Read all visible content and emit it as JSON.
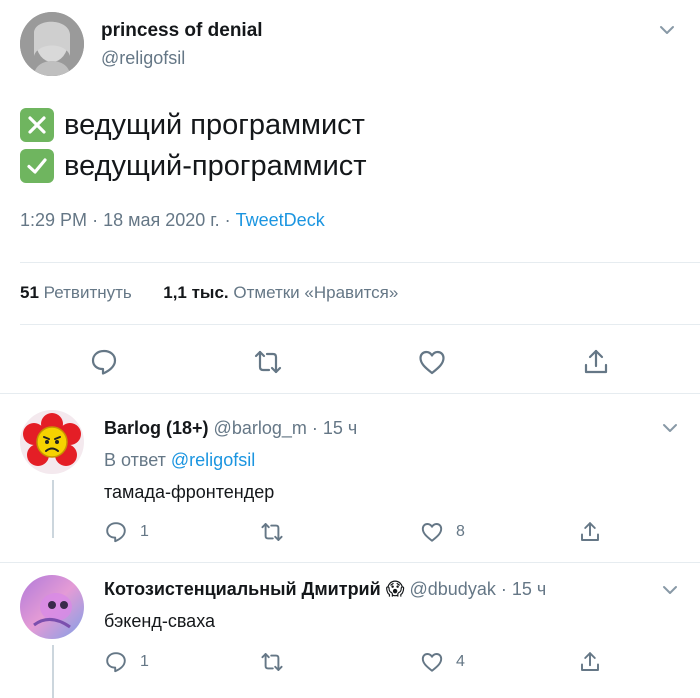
{
  "main_tweet": {
    "author_name": "princess of denial",
    "author_handle": "@religofsil",
    "lines": [
      {
        "icon": "cross-mark-emoji",
        "text": "ведущий программист"
      },
      {
        "icon": "check-mark-emoji",
        "text": "ведущий-программист"
      }
    ],
    "time": "1:29 PM",
    "date": "18 мая 2020 г.",
    "source": "TweetDeck",
    "retweets_count": "51",
    "retweets_label": "Ретвитнуть",
    "likes_count": "1,1 тыс.",
    "likes_label": "Отметки «Нравится»"
  },
  "replies": [
    {
      "author_name": "Barlog (18+)",
      "author_handle": "@barlog_m",
      "time": "15 ч",
      "reply_to_prefix": "В ответ",
      "reply_to_handle": "@religofsil",
      "text": "тамада-фронтендер",
      "reply_count": "1",
      "like_count": "8"
    },
    {
      "author_name": "Котозистенциальный Дмитрий",
      "author_emoji": "😱",
      "author_handle": "@dbudyak",
      "time": "15 ч",
      "text": "бэкенд-сваха",
      "reply_count": "1",
      "like_count": "4"
    }
  ],
  "colors": {
    "link": "#1b95e0",
    "muted": "#657786",
    "divider": "#e6ecf0",
    "emoji_green": "#6fb55f"
  }
}
